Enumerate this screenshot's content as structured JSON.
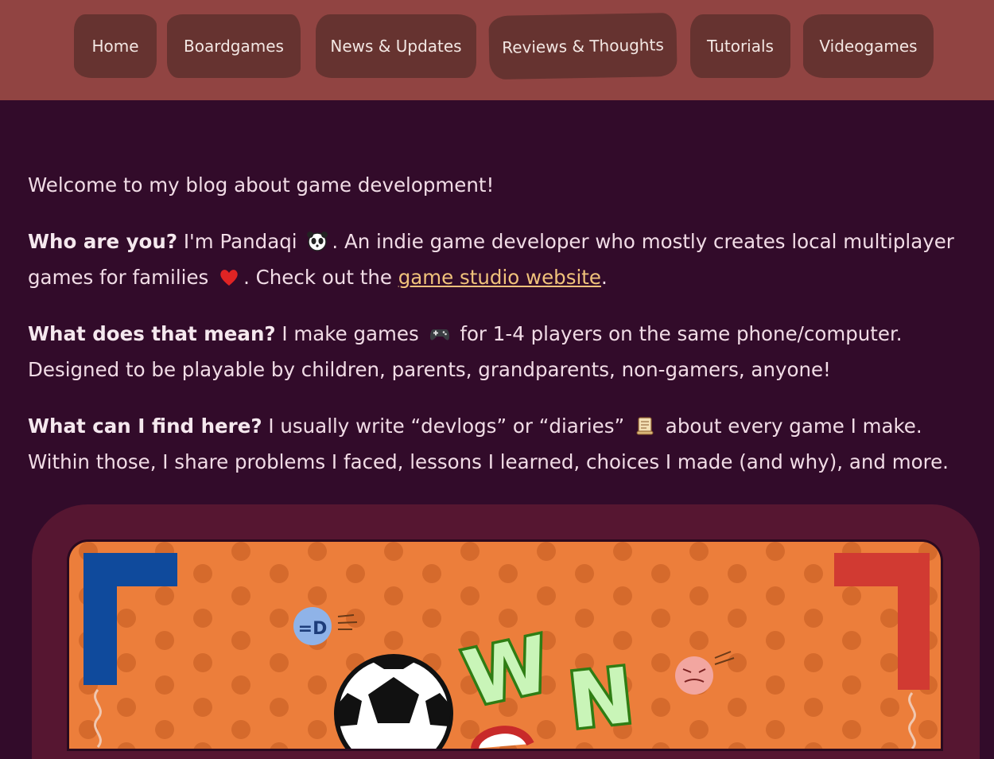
{
  "nav": {
    "items": [
      {
        "label": "Home"
      },
      {
        "label": "Boardgames"
      },
      {
        "label": "News & Updates"
      },
      {
        "label": "Reviews & Thoughts"
      },
      {
        "label": "Tutorials"
      },
      {
        "label": "Videogames"
      }
    ]
  },
  "intro": {
    "welcome": "Welcome to my blog about game development!",
    "who": {
      "q": "Who are you?",
      "a1": " I'm Pandaqi ",
      "a2": ". An indie game developer who mostly creates local multiplayer games for families ",
      "a3": ". Check out the ",
      "link": "game studio website",
      "a4": "."
    },
    "what": {
      "q": "What does that mean?",
      "a1": " I make games ",
      "a2": " for 1-4 players on the same phone/computer. Designed to be playable by children, parents, grandparents, non-gamers, anyone!"
    },
    "find": {
      "q": "What can I find here?",
      "a1": " I usually write “devlogs” or “diaries” ",
      "a2": " about every game I make. Within those, I share problems I faced, lessons I learned, choices I made (and why), and more."
    }
  },
  "banner": {
    "letters": [
      "W",
      "N"
    ],
    "face_text": "=D"
  },
  "colors": {
    "topbar": "#914442",
    "nav_button": "#663330",
    "background": "#320b2a",
    "link": "#f0c27b",
    "banner_orange": "#ec7e3b",
    "frame": "#561631"
  },
  "icons": [
    "panda-icon",
    "heart-icon",
    "gamepad-icon",
    "scroll-icon"
  ]
}
